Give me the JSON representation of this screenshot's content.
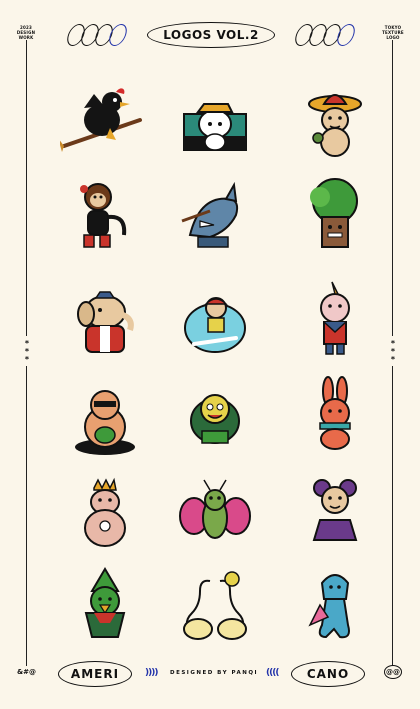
{
  "header": {
    "title": "LOGOS VOL.2",
    "left_note": [
      "2023",
      "DESIGN",
      "WORK"
    ],
    "right_note": [
      "TOKYO",
      "TEXTURE",
      "LOGO"
    ]
  },
  "side_marks": {
    "left": "***",
    "right": "***"
  },
  "logos": [
    {
      "name": "witch-rooster-on-broom-logo"
    },
    {
      "name": "cat-with-hat-badge-logo"
    },
    {
      "name": "sombrero-bear-logo"
    },
    {
      "name": "monkey-calling-logo"
    },
    {
      "name": "shark-mechanic-logo"
    },
    {
      "name": "tree-monster-logo"
    },
    {
      "name": "elephant-in-suit-logo"
    },
    {
      "name": "skateboard-kid-logo"
    },
    {
      "name": "unicorn-pig-logo"
    },
    {
      "name": "cool-cat-with-glasses-logo"
    },
    {
      "name": "yellow-peacock-logo"
    },
    {
      "name": "scarf-rabbit-logo"
    },
    {
      "name": "crowned-hippo-logo"
    },
    {
      "name": "butterfly-bug-logo"
    },
    {
      "name": "purple-mouse-logo"
    },
    {
      "name": "green-bird-wizard-logo"
    },
    {
      "name": "swan-love-logo"
    },
    {
      "name": "blue-mermaid-logo"
    }
  ],
  "footer": {
    "left_pill": "AMERI",
    "right_pill": "CANO",
    "designed_by": "DESIGNED BY PANQI",
    "left_brackets": "))))",
    "right_brackets": "((((",
    "left_mark": "&#@",
    "right_mark": "@@"
  },
  "colors": {
    "background": "#fbf6ea",
    "ink": "#111111",
    "accent_blue": "#2233aa"
  }
}
